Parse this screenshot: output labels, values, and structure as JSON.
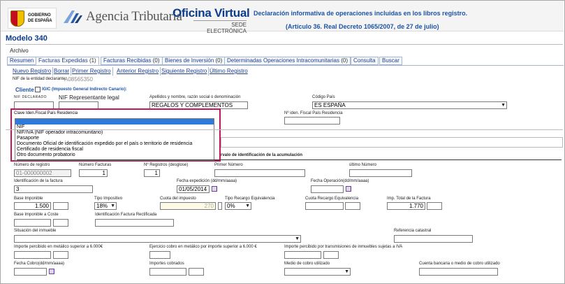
{
  "header": {
    "gov_text": "GOBIERNO\nDE ESPAÑA",
    "agency": "Agencia Tributaria",
    "office_title": "Oficina Virtual",
    "office_sub": "SEDE ELECTRÓNICA",
    "declaration_line1": "Declaración informativa de operaciones incluidas en los libros registro.",
    "declaration_line2": "(Artículo 36. Real Decreto 1065/2007, de 27 de julio)"
  },
  "model": "Modelo 340",
  "menu_archivo": "Archivo",
  "tabs": [
    {
      "label": "Resumen",
      "count": ""
    },
    {
      "label": "Facturas Expedidas",
      "count": "(1)"
    },
    {
      "label": "Facturas Recibidas",
      "count": "(0)"
    },
    {
      "label": "Bienes de Inversión",
      "count": "(0)"
    },
    {
      "label": "Determinadas Operaciones Intracomunitarias",
      "count": "(0)"
    },
    {
      "label": "Consulta",
      "count": ""
    },
    {
      "label": "Buscar",
      "count": ""
    }
  ],
  "subtabs": [
    "Nuevo Registro",
    "Borrar",
    "Primer Registro",
    "Anterior Registro",
    "Siguiente Registro",
    "Último Registro"
  ],
  "nif_entity": {
    "label": "NIF de la entidad declarante:",
    "value": "A08565350"
  },
  "cliente": {
    "label": "Cliente",
    "igic": "IGIC (Impuesto General Indirecto Canario):"
  },
  "fields": {
    "nif_declarado_label": "NIF DECLARADO",
    "nif_rep_label": "NIF Representante legal",
    "apellidos_label": "Apellidos y nombre, razón social o denominación",
    "apellidos_value": "REGALOS Y COMPLEMENTOS",
    "codigo_pais_label": "Código País",
    "codigo_pais_value": "ES ESPAÑA",
    "clave_label": "Clave Iden.Fiscal País Residencia",
    "n_iden_label": "Nº iden. Fiscal País Residencia",
    "intervalo_label": "rvalo de identificación de la acumulación",
    "num_registro_label": "Número de registro",
    "num_registro_value": "01-000000002",
    "num_facturas_label": "Número Facturas",
    "num_facturas_value": "1",
    "n_registros_label": "Nº Registros (desglose)",
    "n_registros_value": "1",
    "primer_numero_label": "Primer Número",
    "ultimo_numero_label": "último Número",
    "ident_factura_label": "Identificación de la factura",
    "ident_factura_value": "3",
    "fecha_exp_label": "Fecha expedición (dd/mm/aaaa)",
    "fecha_exp_value": "01/05/2014",
    "fecha_op_label": "Fecha Operación(dd/mm/aaaa)",
    "base_imponible_label": "Base Imponible",
    "base_imponible_value": "1.500",
    "tipo_impositivo_label": "Tipo Impositivo",
    "tipo_impositivo_value": "18%",
    "cuota_label": "Cuota del impuesto",
    "cuota_value": "270",
    "tipo_recargo_label": "Tipo Recargo Equivalencia",
    "tipo_recargo_value": "0%",
    "cuota_recargo_label": "Cuota Recargo Equivalencia",
    "imp_total_label": "Imp. Total de la Factura",
    "imp_total_value": "1.770",
    "base_coste_label": "Base Imponible a Coste",
    "ident_rect_label": "Identificación Factura Rectificada",
    "situacion_label": "Situación del inmueble",
    "ref_catastral_label": "Referencia catastral",
    "importe_metalico_label": "Importe percibido en metálico superior a 6.000€",
    "ejercicio_cobro_label": "Ejercicio cobro en metálico por importe superior a 6.000 €",
    "importe_trans_label": "Importe percibido por transmisiones de inmuebles sujetas a IVA",
    "fecha_cobro_label": "Fecha Cobro(dd/mm/aaaa)",
    "importes_cobrados_label": "Importes cobrados",
    "medio_cobro_label": "Medio de cobro utilizado",
    "cuenta_label": "Cuenta bancaria o medio de cobro utilizado"
  },
  "dropdown_options": [
    "",
    "NIF",
    "NIF/IVA (NIF operador intracomunitario)",
    "Pasaporte",
    "Documento Oficial de identificación expedido por el país o territorio de residencia",
    "Certificado de residencia fiscal",
    "Otro documento probatorio"
  ],
  "colors": {
    "brand_blue": "#0c3c8c",
    "link_blue": "#1f3f8f",
    "highlight": "#c2185b",
    "selected": "#2f7ad8"
  }
}
